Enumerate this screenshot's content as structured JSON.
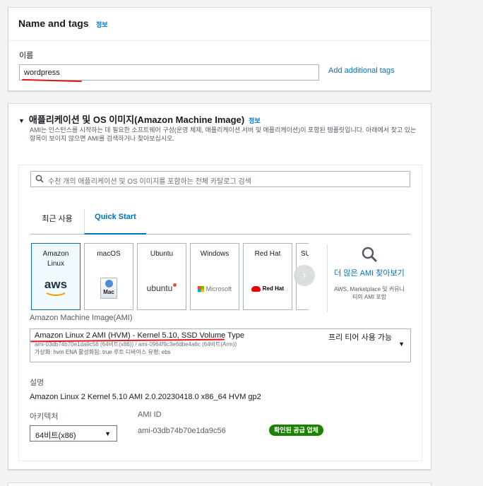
{
  "name_tags": {
    "title": "Name and tags",
    "info": "정보",
    "name_label": "이름",
    "name_value": "wordpress",
    "add_tags": "Add additional tags"
  },
  "ami": {
    "title": "애플리케이션 및 OS 이미지(Amazon Machine Image)",
    "info": "정보",
    "description": "AMI는 인스턴스를 시작하는 데 필요한 소프트웨어 구성(운영 체제, 애플리케이션 서버 및 애플리케이션)이 포함된 템플릿입니다. 아래에서 찾고 있는 항목이 보이지 않으면 AMI를 검색하거나 찾아보십시오.",
    "search_placeholder": "수천 개의 애플리케이션 및 OS 이미지를 포함하는 전체 카탈로그 검색",
    "tabs": [
      "최근 사용",
      "Quick Start"
    ],
    "tiles": [
      {
        "name": "Amazon Linux",
        "logo": "aws"
      },
      {
        "name": "macOS",
        "logo": "Mac"
      },
      {
        "name": "Ubuntu",
        "logo": "ubuntu"
      },
      {
        "name": "Windows",
        "logo": "Microsoft"
      },
      {
        "name": "Red Hat",
        "logo": "Red Hat"
      },
      {
        "name": "SUS",
        "logo": "S"
      }
    ],
    "more_link": "더 많은 AMI 찾아보기",
    "more_sub": "AWS, Marketplace 및 커뮤니티의 AMI 포함",
    "ami_label": "Amazon Machine Image(AMI)",
    "ami_name": "Amazon Linux 2 AMI (HVM) - Kernel 5.10, SSD Volume Type",
    "ami_ids": "ami-03db74b70e1da9c56 (64비트(x86)) / ami-0964f9c3e6dbe4a6c (64비트(Arm))",
    "ami_attrs": "가상화: hvm    ENA 활성화됨: true    루트 디바이스 유형: ebs",
    "free_tier": "프리 티어 사용 가능",
    "desc_label": "설명",
    "desc_value": "Amazon Linux 2 Kernel 5.10 AMI 2.0.20230418.0 x86_64 HVM gp2",
    "arch_label": "아키텍처",
    "arch_value": "64비트(x86)",
    "ami_id_label": "AMI ID",
    "ami_id_value": "ami-03db74b70e1da9c56",
    "verified": "확인된 공급 업체"
  },
  "colors": {
    "link": "#0073bb",
    "annotation": "#e0161b",
    "badge": "#1d8102"
  }
}
